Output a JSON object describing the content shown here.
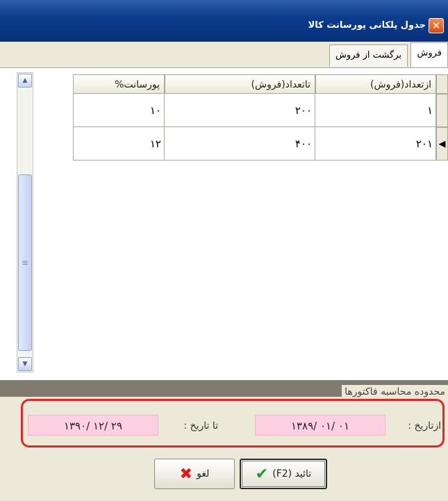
{
  "window": {
    "title": "جدول پلکانی پورسانت کالا",
    "close_icon": "close-icon",
    "close_symbol": "✕"
  },
  "tabs": [
    {
      "label": "فروش",
      "active": true
    },
    {
      "label": "برگشت از فروش",
      "active": false
    }
  ],
  "grid": {
    "columns": [
      "ازتعداد(فروش)",
      "تاتعداد(فروش)",
      "پورسانت%"
    ],
    "rows": [
      {
        "from": "۱",
        "to": "۲۰۰",
        "percent": "۱۰",
        "current": false
      },
      {
        "from": "۲۰۱",
        "to": "۴۰۰",
        "percent": "۱۲",
        "current": true
      }
    ],
    "current_row_marker": "◀",
    "scroll_up_icon": "▲",
    "scroll_down_icon": "▼",
    "scroll_thumb_grip": "≡"
  },
  "invoice_range": {
    "group_title": "محدوده محاسبه فاکتورها",
    "from_label": "ازتاریخ :",
    "from_value": "۱۳۸۹/ ۰۱/ ۰۱",
    "to_label": "تا تاریخ :",
    "to_value": "۱۳۹۰/ ۱۲/ ۲۹"
  },
  "buttons": {
    "confirm_label": "تائید (F2)",
    "confirm_icon": "check-icon",
    "confirm_symbol": "✔",
    "cancel_label": "لغو",
    "cancel_icon": "cross-icon",
    "cancel_symbol": "✖"
  },
  "colors": {
    "highlight_border": "#e02828",
    "date_background": "#ffcfe2"
  }
}
